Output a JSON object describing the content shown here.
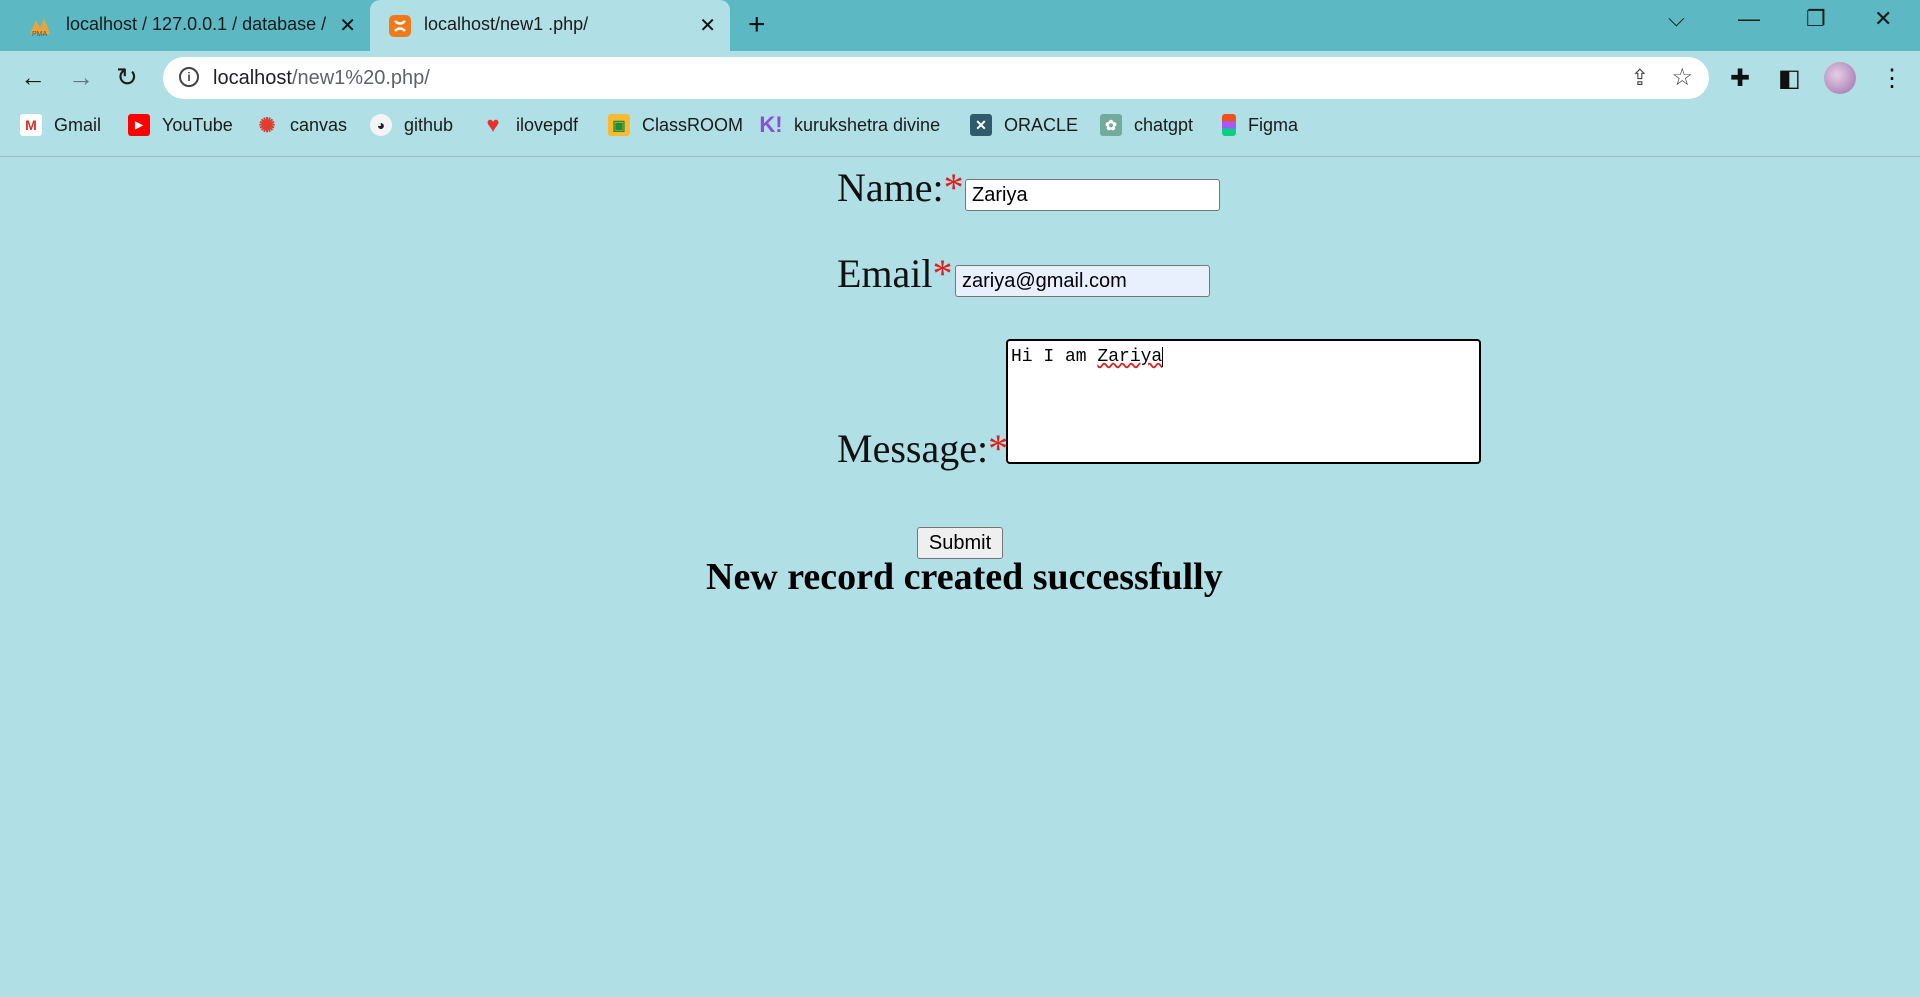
{
  "browser": {
    "tabs": [
      {
        "title": "localhost / 127.0.0.1 / database /",
        "icon": "phpmyadmin-icon"
      },
      {
        "title": "localhost/new1 .php/",
        "icon": "xampp-icon"
      }
    ],
    "url_host": "localhost",
    "url_path": "/new1%20.php/",
    "bookmarks": [
      {
        "label": "Gmail",
        "icon": "gmail-icon"
      },
      {
        "label": "YouTube",
        "icon": "youtube-icon"
      },
      {
        "label": "canvas",
        "icon": "canvas-icon"
      },
      {
        "label": "github",
        "icon": "github-icon"
      },
      {
        "label": "ilovepdf",
        "icon": "ilovepdf-icon"
      },
      {
        "label": "ClassROOM",
        "icon": "classroom-icon"
      },
      {
        "label": "kurukshetra divine",
        "icon": "kurukshetra-icon"
      },
      {
        "label": "ORACLE",
        "icon": "oracle-icon"
      },
      {
        "label": "chatgpt",
        "icon": "chatgpt-icon"
      },
      {
        "label": "Figma",
        "icon": "figma-icon"
      }
    ]
  },
  "form": {
    "name_label": "Name:",
    "name_value": "Zariya",
    "email_label": "Email",
    "email_value": "zariya@gmail.com",
    "message_label": "Message:",
    "message_text": "Hi I am ",
    "message_misspelled": "Zariya",
    "required_mark": "*",
    "submit_label": "Submit"
  },
  "status": {
    "message": "New record created successfully"
  },
  "colors": {
    "page_background": "#b0dfe5",
    "tabbar_background": "#5cb8c3",
    "required_mark": "#e21b1b"
  }
}
